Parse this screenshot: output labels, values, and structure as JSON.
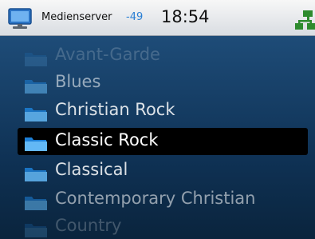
{
  "header": {
    "server_name": "Medienserver",
    "signal": "-49",
    "time": "18:54",
    "server_icon": "monitor-icon",
    "network_icon": "network-icon"
  },
  "list": {
    "items": [
      {
        "label": "Avant-Garde",
        "icon": "folder-icon"
      },
      {
        "label": "Blues",
        "icon": "folder-icon"
      },
      {
        "label": "Christian Rock",
        "icon": "folder-icon"
      },
      {
        "label": "Classic Rock",
        "icon": "folder-icon",
        "selected": true
      },
      {
        "label": "Classical",
        "icon": "folder-icon"
      },
      {
        "label": "Contemporary Christian",
        "icon": "folder-icon"
      },
      {
        "label": "Country",
        "icon": "folder-icon"
      }
    ]
  },
  "colors": {
    "accent": "#2a7fd4",
    "list_background": "#0f3255",
    "selection": "#000000",
    "network_icon": "#2e8b2e"
  }
}
